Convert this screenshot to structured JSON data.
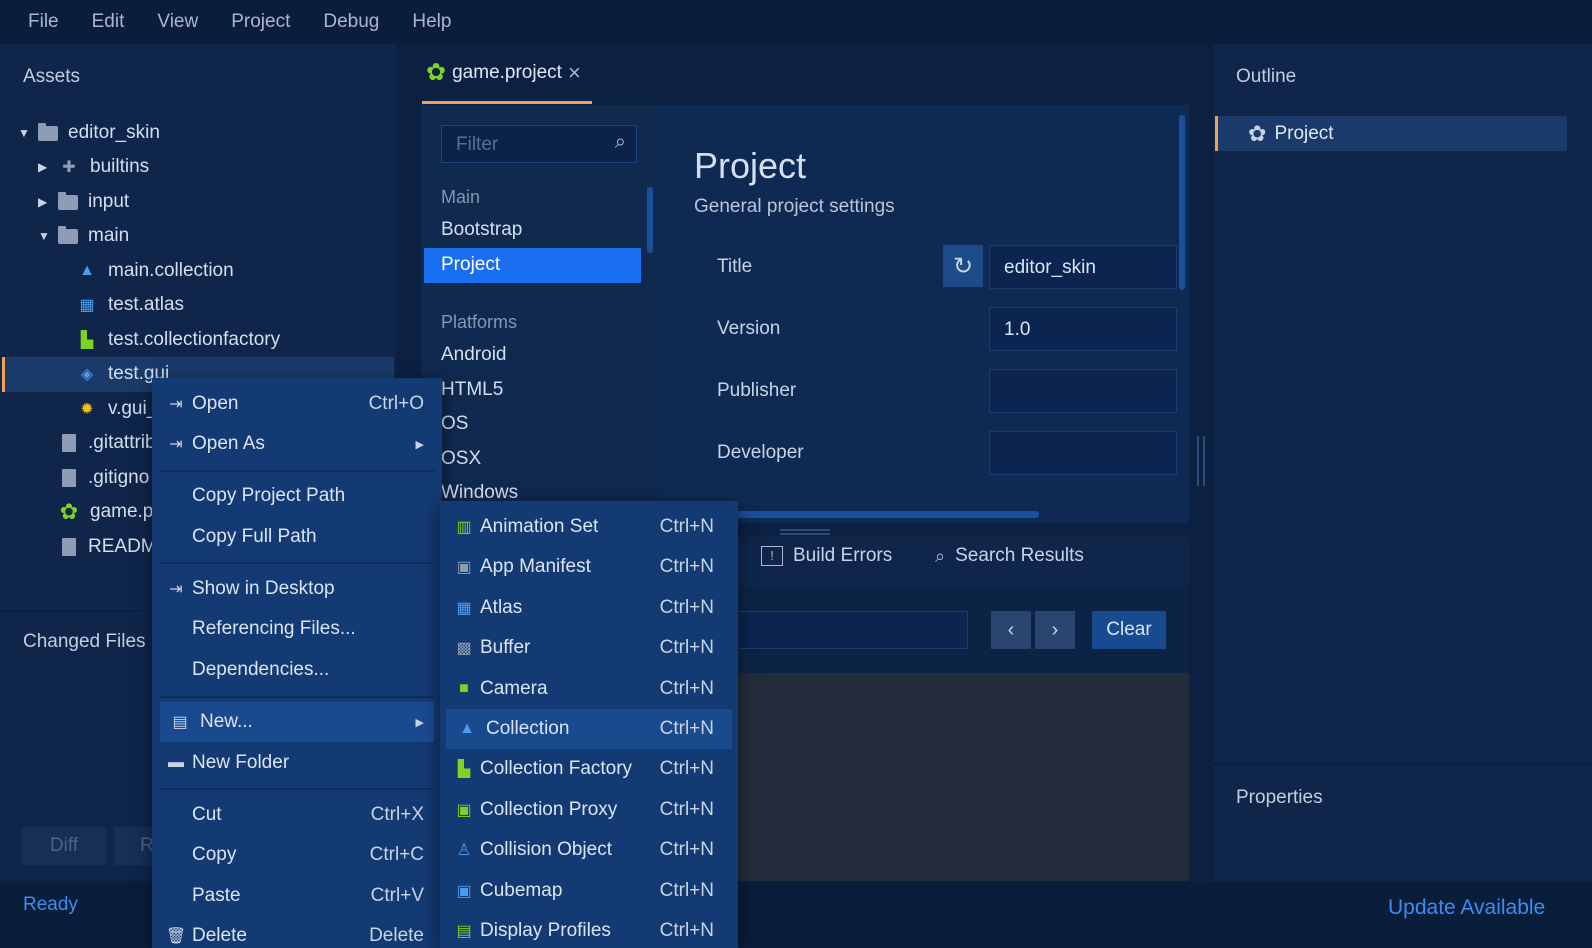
{
  "menubar": [
    "File",
    "Edit",
    "View",
    "Project",
    "Debug",
    "Help"
  ],
  "assets": {
    "title": "Assets",
    "tree": [
      {
        "label": "editor_skin",
        "icon": "folder-icon"
      },
      {
        "label": "builtins",
        "icon": "puzzle-icon"
      },
      {
        "label": "input",
        "icon": "folder-icon"
      },
      {
        "label": "main",
        "icon": "folder-icon"
      },
      {
        "label": "main.collection",
        "icon": "collection-icon"
      },
      {
        "label": "test.atlas",
        "icon": "atlas-icon"
      },
      {
        "label": "test.collectionfactory",
        "icon": "factory-icon"
      },
      {
        "label": "test.gui",
        "icon": "gui-icon"
      },
      {
        "label": "v.gui_",
        "icon": "gear-icon"
      },
      {
        "label": ".gitattrib",
        "icon": "file-icon"
      },
      {
        "label": ".gitigno",
        "icon": "file-icon"
      },
      {
        "label": "game.p",
        "icon": "project-icon"
      },
      {
        "label": "READM",
        "icon": "file-icon"
      }
    ]
  },
  "changed_files": {
    "title": "Changed Files",
    "diff": "Diff",
    "revert": "R"
  },
  "status": {
    "ready": "Ready",
    "update": "Update Available"
  },
  "editor_tab": {
    "label": "game.project",
    "close": "×"
  },
  "settings": {
    "filter_placeholder": "Filter",
    "groups": [
      {
        "header": "Main",
        "items": [
          "Bootstrap",
          "Project"
        ]
      },
      {
        "header": "Platforms",
        "items": [
          "Android",
          "HTML5",
          "iOS",
          "OSX",
          "Windows"
        ]
      }
    ],
    "visible_items": {
      "android": "Android",
      "html5": "HTML5",
      "ios": "OS",
      "osx": "OSX",
      "windows": "Windows"
    },
    "heading": "Project",
    "subheading": "General project settings",
    "fields": [
      {
        "label": "Title",
        "value": "editor_skin"
      },
      {
        "label": "Version",
        "value": "1.0"
      },
      {
        "label": "Publisher",
        "value": ""
      },
      {
        "label": "Developer",
        "value": ""
      }
    ]
  },
  "bottom": {
    "tabs": [
      "Build Errors",
      "Search Results"
    ],
    "clear": "Clear"
  },
  "outline": {
    "title": "Outline",
    "item": "Project"
  },
  "properties": {
    "title": "Properties"
  },
  "context_menu": {
    "items": [
      {
        "label": "Open",
        "shortcut": "Ctrl+O",
        "icon": "open-icon"
      },
      {
        "label": "Open As",
        "shortcut": "",
        "icon": "open-icon"
      },
      {
        "label": "Copy Project Path",
        "shortcut": "",
        "icon": ""
      },
      {
        "label": "Copy Full Path",
        "shortcut": "",
        "icon": ""
      },
      {
        "label": "Show in Desktop",
        "shortcut": "",
        "icon": "open-icon"
      },
      {
        "label": "Referencing Files...",
        "shortcut": "",
        "icon": ""
      },
      {
        "label": "Dependencies...",
        "shortcut": "",
        "icon": ""
      },
      {
        "label": "New...",
        "shortcut": "",
        "icon": "file-icon"
      },
      {
        "label": "New Folder",
        "shortcut": "",
        "icon": "folder-icon"
      },
      {
        "label": "Cut",
        "shortcut": "Ctrl+X",
        "icon": ""
      },
      {
        "label": "Copy",
        "shortcut": "Ctrl+C",
        "icon": ""
      },
      {
        "label": "Paste",
        "shortcut": "Ctrl+V",
        "icon": ""
      },
      {
        "label": "Delete",
        "shortcut": "Delete",
        "icon": "trash-icon"
      }
    ]
  },
  "submenu": {
    "items": [
      {
        "label": "Animation Set",
        "shortcut": "Ctrl+N"
      },
      {
        "label": "App Manifest",
        "shortcut": "Ctrl+N"
      },
      {
        "label": "Atlas",
        "shortcut": "Ctrl+N"
      },
      {
        "label": "Buffer",
        "shortcut": "Ctrl+N"
      },
      {
        "label": "Camera",
        "shortcut": "Ctrl+N"
      },
      {
        "label": "Collection",
        "shortcut": "Ctrl+N"
      },
      {
        "label": "Collection Factory",
        "shortcut": "Ctrl+N"
      },
      {
        "label": "Collection Proxy",
        "shortcut": "Ctrl+N"
      },
      {
        "label": "Collision Object",
        "shortcut": "Ctrl+N"
      },
      {
        "label": "Cubemap",
        "shortcut": "Ctrl+N"
      },
      {
        "label": "Display Profiles",
        "shortcut": "Ctrl+N"
      }
    ]
  },
  "colors": {
    "accent": "#f0a050",
    "selection": "#1a6ef0",
    "green": "#7ed321",
    "blue": "#4a9ef0"
  }
}
